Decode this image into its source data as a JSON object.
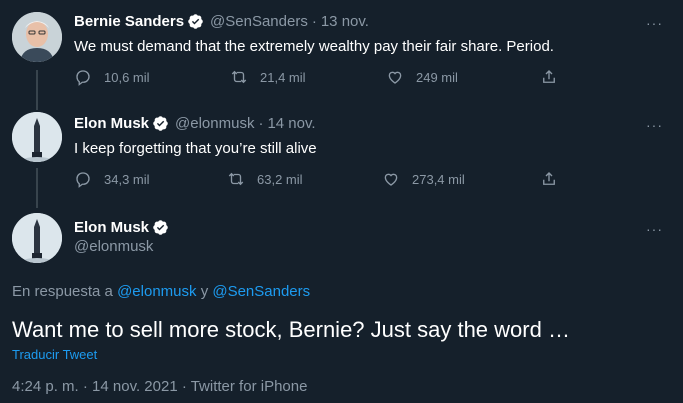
{
  "tweets": [
    {
      "name": "Bernie Sanders",
      "handle": "@SenSanders",
      "time": "13 nov.",
      "text": "We must demand that the extremely wealthy pay their fair share. Period.",
      "replies": "10,6 mil",
      "retweets": "21,4 mil",
      "likes": "249 mil"
    },
    {
      "name": "Elon Musk",
      "handle": "@elonmusk",
      "time": "14 nov.",
      "text": "I keep forgetting that you’re still alive",
      "replies": "34,3 mil",
      "retweets": "63,2 mil",
      "likes": "273,4 mil"
    }
  ],
  "focus": {
    "name": "Elon Musk",
    "handle": "@elonmusk",
    "reply_prefix": "En respuesta a",
    "reply_mention_1": "@elonmusk",
    "reply_joiner": "y",
    "reply_mention_2": "@SenSanders",
    "text": "Want me to sell more stock, Bernie? Just say the word …",
    "translate": "Traducir Tweet",
    "meta": "4:24 p. m. · 14 nov. 2021 · Twitter for iPhone"
  },
  "ui": {
    "more": "···",
    "dot": "·"
  },
  "colors": {
    "background": "#15202b",
    "text_secondary": "#8b98a5",
    "accent": "#1d9bf0",
    "verified": "#ffffff"
  }
}
